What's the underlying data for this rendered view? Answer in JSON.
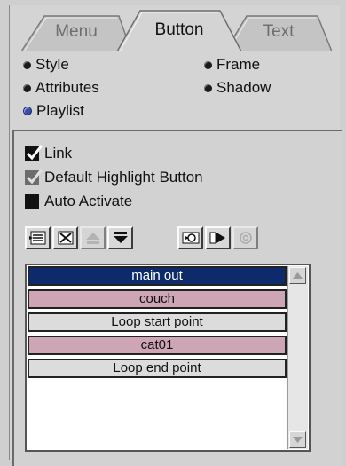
{
  "tabs": [
    {
      "label": "Menu",
      "active": false
    },
    {
      "label": "Button",
      "active": true
    },
    {
      "label": "Text",
      "active": false
    }
  ],
  "options": {
    "style": "Style",
    "frame": "Frame",
    "attributes": "Attributes",
    "shadow": "Shadow",
    "playlist": "Playlist"
  },
  "checkboxes": {
    "link": {
      "label": "Link",
      "checked": true
    },
    "default_highlight": {
      "label": "Default Highlight Button",
      "checked": true,
      "enabled": false
    },
    "auto_activate": {
      "label": "Auto Activate",
      "checked": false
    }
  },
  "toolbar": {
    "icons": [
      "insert-item-icon",
      "delete-item-icon",
      "move-up-icon",
      "move-down-icon",
      "refresh-icon",
      "play-icon",
      "loop-icon"
    ]
  },
  "playlist": {
    "items": [
      {
        "label": "main out",
        "style": "selected"
      },
      {
        "label": "couch",
        "style": "pink"
      },
      {
        "label": "Loop start point",
        "style": "grey"
      },
      {
        "label": "cat01",
        "style": "pink"
      },
      {
        "label": "Loop end point",
        "style": "grey"
      }
    ]
  },
  "colors": {
    "selected": "#0d2a6b",
    "pink": "#cea5b5",
    "grey": "#dcdcdc",
    "panel": "#d4d4d4"
  }
}
